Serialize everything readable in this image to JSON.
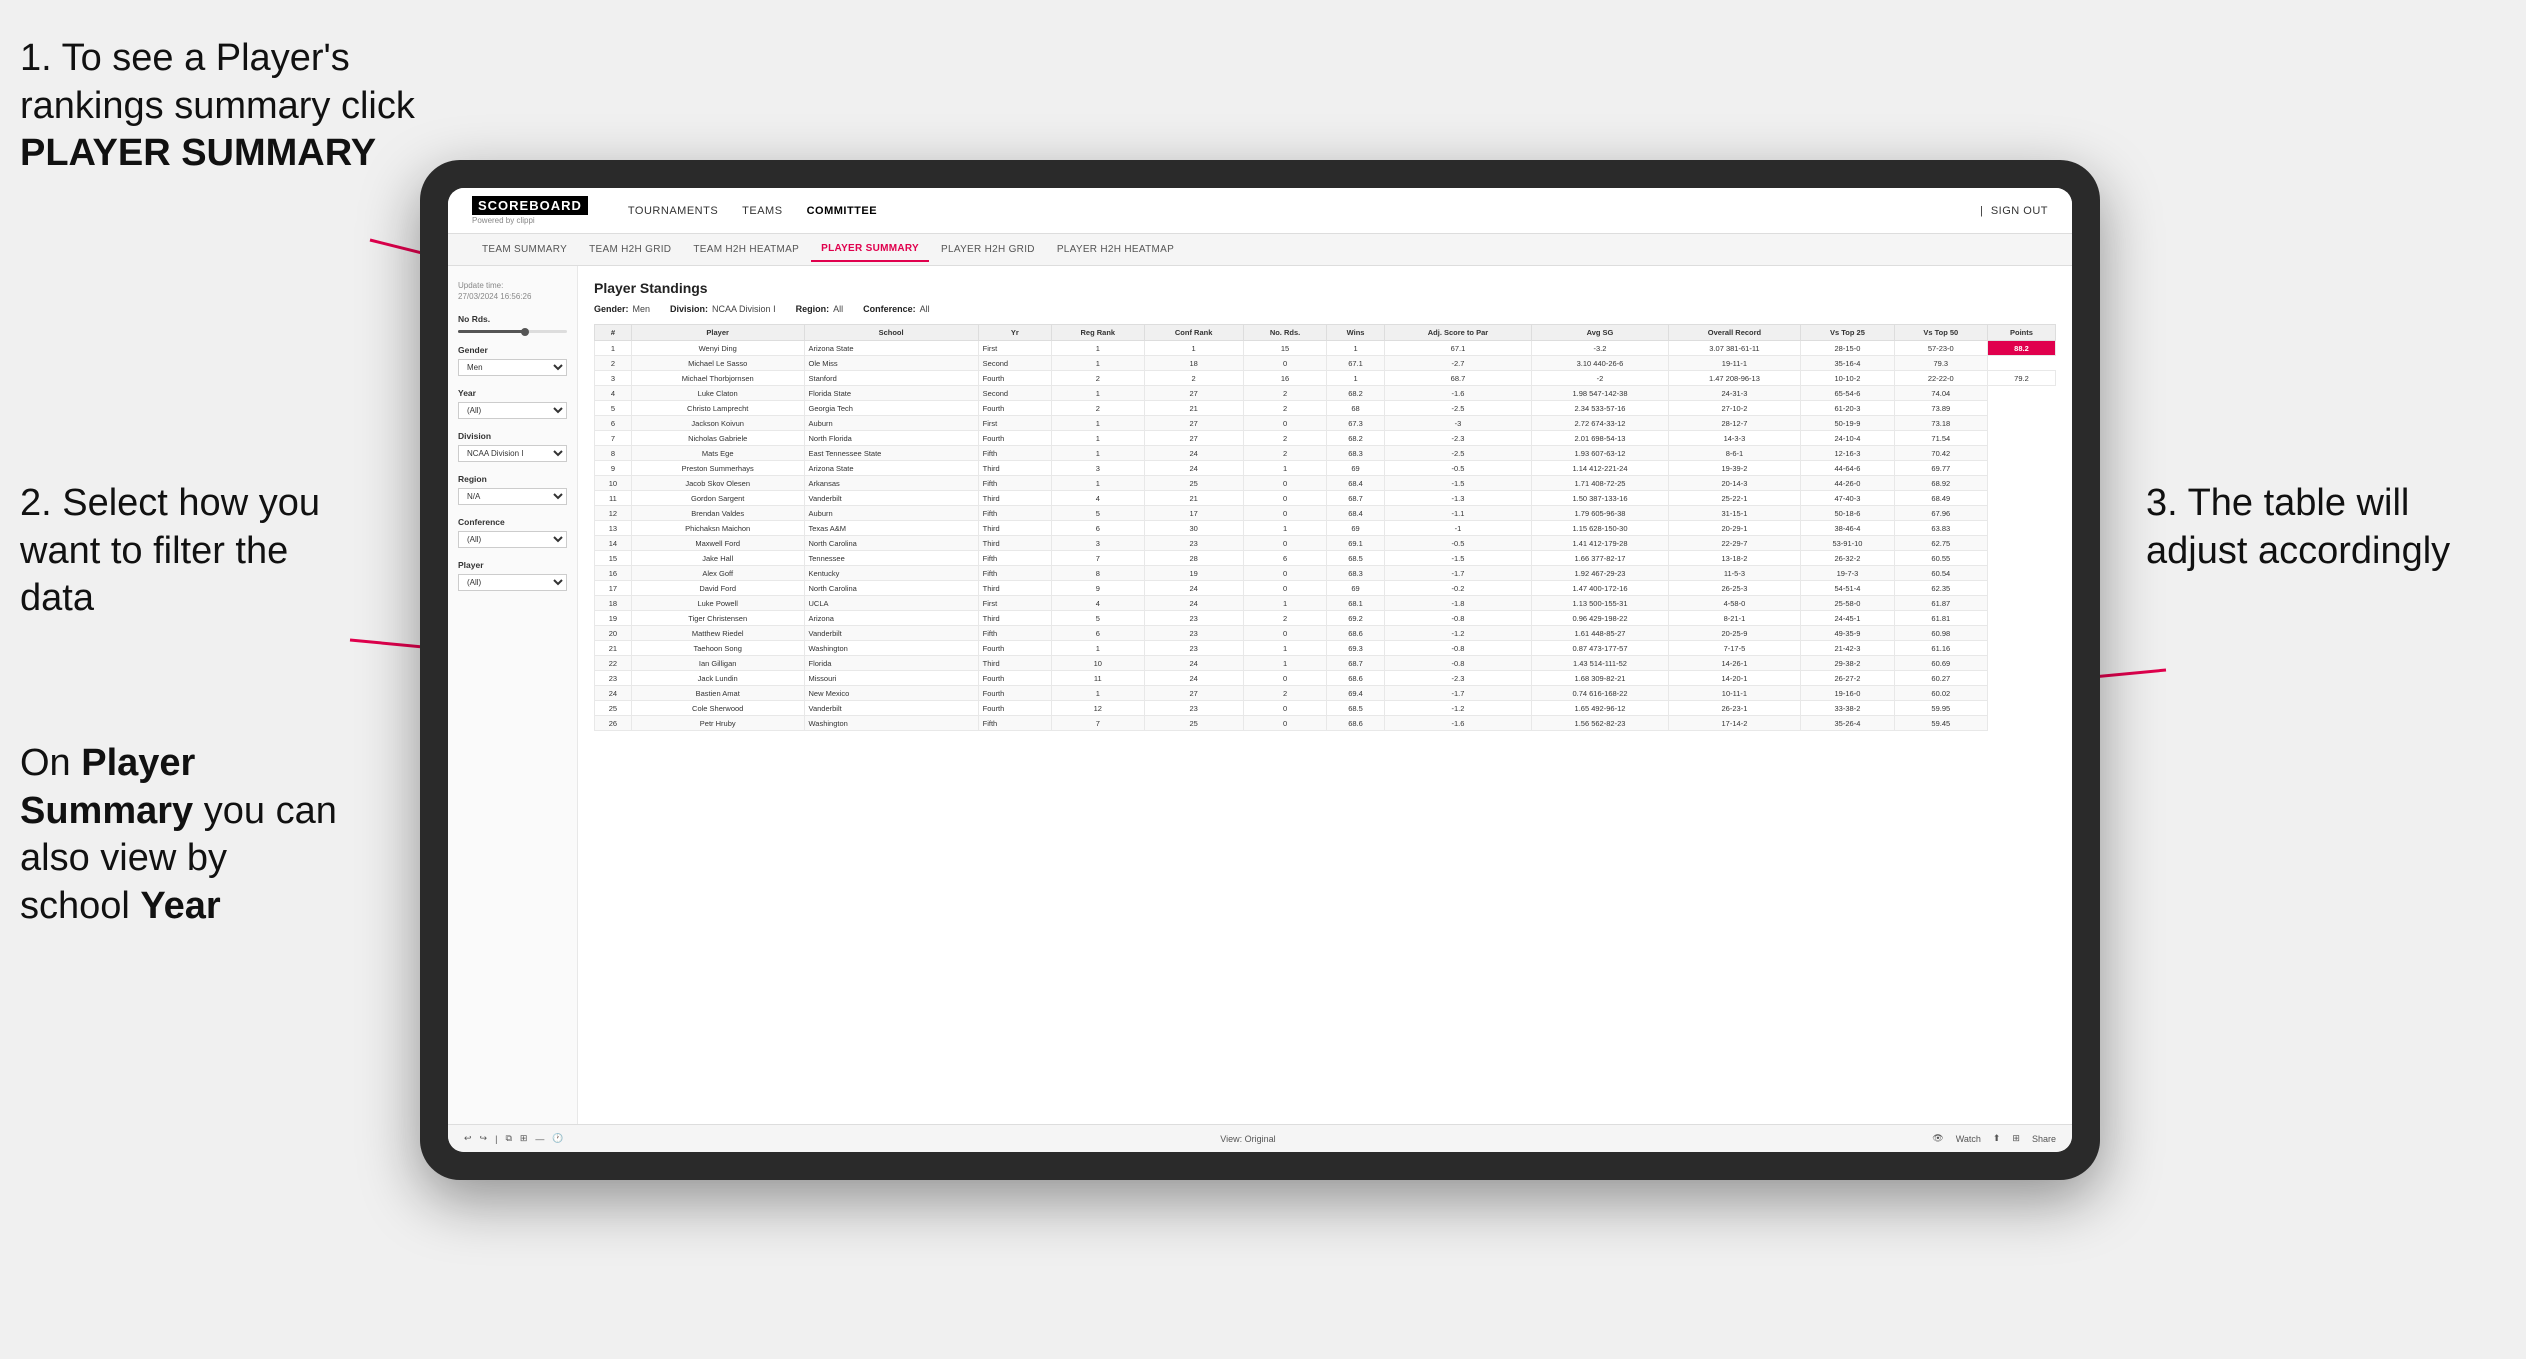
{
  "instructions": {
    "step1": "1. To see a Player's rankings summary click ",
    "step1_bold": "PLAYER SUMMARY",
    "step2_title": "2. Select how you want to filter the data",
    "step_on_title": "On ",
    "step_on_bold1": "Player Summary",
    "step_on_mid": " you can also view by school ",
    "step_on_bold2": "Year",
    "step3": "3. The table will adjust accordingly"
  },
  "nav": {
    "logo": "SCOREBOARD",
    "logo_sub": "Powered by clippi",
    "items": [
      "TOURNAMENTS",
      "TEAMS",
      "COMMITTEE"
    ],
    "sign_out": "Sign out"
  },
  "sub_nav": {
    "items": [
      "TEAM SUMMARY",
      "TEAM H2H GRID",
      "TEAM H2H HEATMAP",
      "PLAYER SUMMARY",
      "PLAYER H2H GRID",
      "PLAYER H2H HEATMAP"
    ]
  },
  "sidebar": {
    "update_label": "Update time:",
    "update_value": "27/03/2024 16:56:26",
    "no_rds_label": "No Rds.",
    "gender_label": "Gender",
    "gender_value": "Men",
    "year_label": "Year",
    "year_value": "(All)",
    "division_label": "Division",
    "division_value": "NCAA Division I",
    "region_label": "Region",
    "region_value": "N/A",
    "conference_label": "Conference",
    "conference_value": "(All)",
    "player_label": "Player",
    "player_value": "(All)"
  },
  "table": {
    "title": "Player Standings",
    "filters": {
      "gender_label": "Gender:",
      "gender_value": "Men",
      "division_label": "Division:",
      "division_value": "NCAA Division I",
      "region_label": "Region:",
      "region_value": "All",
      "conference_label": "Conference:",
      "conference_value": "All"
    },
    "columns": [
      "#",
      "Player",
      "School",
      "Yr",
      "Reg Rank",
      "Conf Rank",
      "No. Rds.",
      "Wins",
      "Adj. Score to Par",
      "Avg SG",
      "Overall Record",
      "Vs Top 25",
      "Vs Top 50",
      "Points"
    ],
    "rows": [
      [
        1,
        "Wenyi Ding",
        "Arizona State",
        "First",
        1,
        1,
        15,
        1,
        67.1,
        -3.2,
        "3.07 381-61-11",
        "28-15-0",
        "57-23-0",
        "88.2"
      ],
      [
        2,
        "Michael Le Sasso",
        "Ole Miss",
        "Second",
        1,
        18,
        0,
        67.1,
        -2.7,
        "3.10 440-26-6",
        "19-11-1",
        "35-16-4",
        "79.3"
      ],
      [
        3,
        "Michael Thorbjornsen",
        "Stanford",
        "Fourth",
        2,
        2,
        16,
        1,
        68.7,
        -2.0,
        "1.47 208-96-13",
        "10-10-2",
        "22-22-0",
        "79.2"
      ],
      [
        4,
        "Luke Claton",
        "Florida State",
        "Second",
        1,
        27,
        2,
        68.2,
        -1.6,
        "1.98 547-142-38",
        "24-31-3",
        "65-54-6",
        "74.04"
      ],
      [
        5,
        "Christo Lamprecht",
        "Georgia Tech",
        "Fourth",
        2,
        21,
        2,
        68.0,
        -2.5,
        "2.34 533-57-16",
        "27-10-2",
        "61-20-3",
        "73.89"
      ],
      [
        6,
        "Jackson Koivun",
        "Auburn",
        "First",
        1,
        27,
        0,
        67.3,
        -3.0,
        "2.72 674-33-12",
        "28-12-7",
        "50-19-9",
        "73.18"
      ],
      [
        7,
        "Nicholas Gabriele",
        "North Florida",
        "Fourth",
        1,
        27,
        2,
        68.2,
        -2.3,
        "2.01 698-54-13",
        "14-3-3",
        "24-10-4",
        "71.54"
      ],
      [
        8,
        "Mats Ege",
        "East Tennessee State",
        "Fifth",
        1,
        24,
        2,
        68.3,
        -2.5,
        "1.93 607-63-12",
        "8-6-1",
        "12-16-3",
        "70.42"
      ],
      [
        9,
        "Preston Summerhays",
        "Arizona State",
        "Third",
        3,
        24,
        1,
        69.0,
        -0.5,
        "1.14 412-221-24",
        "19-39-2",
        "44-64-6",
        "69.77"
      ],
      [
        10,
        "Jacob Skov Olesen",
        "Arkansas",
        "Fifth",
        1,
        25,
        0,
        68.4,
        -1.5,
        "1.71 408-72-25",
        "20-14-3",
        "44-26-0",
        "68.92"
      ],
      [
        11,
        "Gordon Sargent",
        "Vanderbilt",
        "Third",
        4,
        21,
        0,
        68.7,
        -1.3,
        "1.50 387-133-16",
        "25-22-1",
        "47-40-3",
        "68.49"
      ],
      [
        12,
        "Brendan Valdes",
        "Auburn",
        "Fifth",
        5,
        17,
        0,
        68.4,
        -1.1,
        "1.79 605-96-38",
        "31-15-1",
        "50-18-6",
        "67.96"
      ],
      [
        13,
        "Phichaksn Maichon",
        "Texas A&M",
        "Third",
        6,
        30,
        1,
        69.0,
        -1.0,
        "1.15 628-150-30",
        "20-29-1",
        "38-46-4",
        "63.83"
      ],
      [
        14,
        "Maxwell Ford",
        "North Carolina",
        "Third",
        3,
        23,
        0,
        69.1,
        -0.5,
        "1.41 412-179-28",
        "22-29-7",
        "53-91-10",
        "62.75"
      ],
      [
        15,
        "Jake Hall",
        "Tennessee",
        "Fifth",
        7,
        28,
        6,
        68.5,
        -1.5,
        "1.66 377-82-17",
        "13-18-2",
        "26-32-2",
        "60.55"
      ],
      [
        16,
        "Alex Goff",
        "Kentucky",
        "Fifth",
        8,
        19,
        0,
        68.3,
        -1.7,
        "1.92 467-29-23",
        "11-5-3",
        "19-7-3",
        "60.54"
      ],
      [
        17,
        "David Ford",
        "North Carolina",
        "Third",
        9,
        24,
        0,
        69.0,
        -0.2,
        "1.47 400-172-16",
        "26-25-3",
        "54-51-4",
        "62.35"
      ],
      [
        18,
        "Luke Powell",
        "UCLA",
        "First",
        4,
        24,
        1,
        68.1,
        -1.8,
        "1.13 500-155-31",
        "4-58-0",
        "25-58-0",
        "61.87"
      ],
      [
        19,
        "Tiger Christensen",
        "Arizona",
        "Third",
        5,
        23,
        2,
        69.2,
        -0.8,
        "0.96 429-198-22",
        "8-21-1",
        "24-45-1",
        "61.81"
      ],
      [
        20,
        "Matthew Riedel",
        "Vanderbilt",
        "Fifth",
        6,
        23,
        0,
        68.6,
        -1.2,
        "1.61 448-85-27",
        "20-25-9",
        "49-35-9",
        "60.98"
      ],
      [
        21,
        "Taehoon Song",
        "Washington",
        "Fourth",
        1,
        23,
        1,
        69.3,
        -0.8,
        "0.87 473-177-57",
        "7-17-5",
        "21-42-3",
        "61.16"
      ],
      [
        22,
        "Ian Gilligan",
        "Florida",
        "Third",
        10,
        24,
        1,
        68.7,
        -0.8,
        "1.43 514-111-52",
        "14-26-1",
        "29-38-2",
        "60.69"
      ],
      [
        23,
        "Jack Lundin",
        "Missouri",
        "Fourth",
        11,
        24,
        0,
        68.6,
        -2.3,
        "1.68 309-82-21",
        "14-20-1",
        "26-27-2",
        "60.27"
      ],
      [
        24,
        "Bastien Amat",
        "New Mexico",
        "Fourth",
        1,
        27,
        2,
        69.4,
        -1.7,
        "0.74 616-168-22",
        "10-11-1",
        "19-16-0",
        "60.02"
      ],
      [
        25,
        "Cole Sherwood",
        "Vanderbilt",
        "Fourth",
        12,
        23,
        0,
        68.5,
        -1.2,
        "1.65 492-96-12",
        "26-23-1",
        "33-38-2",
        "59.95"
      ],
      [
        26,
        "Petr Hruby",
        "Washington",
        "Fifth",
        7,
        25,
        0,
        68.6,
        -1.6,
        "1.56 562-82-23",
        "17-14-2",
        "35-26-4",
        "59.45"
      ]
    ]
  },
  "bottom_bar": {
    "view_label": "View: Original",
    "watch_label": "Watch",
    "share_label": "Share"
  }
}
